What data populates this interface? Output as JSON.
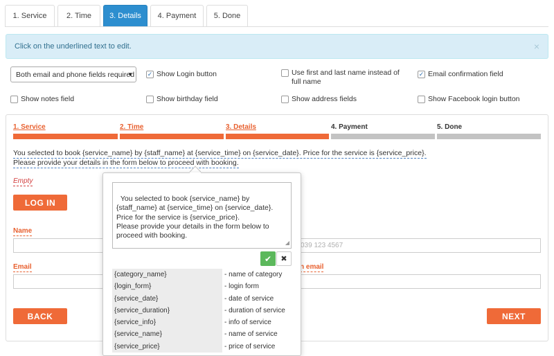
{
  "tabs": [
    {
      "label": "1. Service"
    },
    {
      "label": "2. Time"
    },
    {
      "label": "3. Details"
    },
    {
      "label": "4. Payment"
    },
    {
      "label": "5. Done"
    }
  ],
  "alert": {
    "text": "Click on the underlined text to edit.",
    "close": "×"
  },
  "options": {
    "fields_select": "Both email and phone fields required",
    "show_login": "Show Login button",
    "use_first_last": "Use first and last name instead of full name",
    "email_confirmation": "Email confirmation field",
    "show_notes": "Show notes field",
    "show_birthday": "Show birthday field",
    "show_address": "Show address fields",
    "show_facebook": "Show Facebook login button",
    "checkmark": "✓"
  },
  "progress": {
    "steps": [
      "1. Service",
      "2. Time",
      "3. Details",
      "4. Payment",
      "5. Done"
    ]
  },
  "form": {
    "info_line1": "You selected to book {service_name} by {staff_name} at {service_time} on {service_date}. Price for the service is {service_price}.",
    "info_line2": "Please provide your details in the form below to proceed with booking.",
    "empty": "Empty",
    "login_button": "LOG IN",
    "name_label": "Name",
    "email_label": "Email",
    "email_conf_label_partial": "n email",
    "phone_placeholder_partial": "039 123 4567",
    "back_button": "BACK",
    "next_button": "NEXT"
  },
  "popover": {
    "textarea_value": "You selected to book {service_name} by {staff_name} at {service_time} on {service_date}. Price for the service is {service_price}.\nPlease provide your details in the form below to proceed with booking.",
    "ok_icon": "✔",
    "cancel_icon": "✖",
    "codes": [
      {
        "key": "{category_name}",
        "desc": "- name of category"
      },
      {
        "key": "{login_form}",
        "desc": "- login form"
      },
      {
        "key": "{service_date}",
        "desc": "- date of service"
      },
      {
        "key": "{service_duration}",
        "desc": "- duration of service"
      },
      {
        "key": "{service_info}",
        "desc": "- info of service"
      },
      {
        "key": "{service_name}",
        "desc": "- name of service"
      },
      {
        "key": "{service_price}",
        "desc": "- price of service"
      }
    ]
  }
}
